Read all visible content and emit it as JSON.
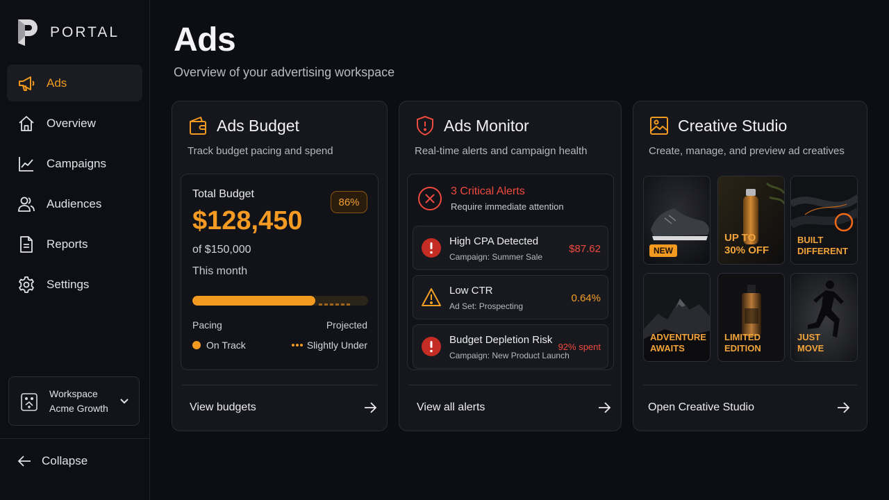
{
  "app": {
    "brand_name": "PORTAL",
    "accent_color": "#f39a20",
    "danger_color": "#ef4a3e"
  },
  "sidebar": {
    "items": [
      {
        "label": "Ads",
        "icon": "megaphone-icon",
        "active": true
      },
      {
        "label": "Overview",
        "icon": "home-icon"
      },
      {
        "label": "Campaigns",
        "icon": "line-chart-icon"
      },
      {
        "label": "Audiences",
        "icon": "users-icon"
      },
      {
        "label": "Reports",
        "icon": "document-icon"
      },
      {
        "label": "Settings",
        "icon": "gear-icon"
      }
    ],
    "workspace": {
      "label": "Workspace",
      "name": "Acme Growth"
    },
    "collapse_label": "Collapse"
  },
  "header": {
    "title": "Ads",
    "subtitle": "Overview of your advertising workspace"
  },
  "budget": {
    "title": "Ads Budget",
    "description": "Track budget pacing and spend",
    "total_label": "Total Budget",
    "percent_badge": "86%",
    "amount": "$128,450",
    "of_total": "of $150,000",
    "period": "This month",
    "progress_fraction": 0.7,
    "projected_fraction": 0.2,
    "pacing_label": "Pacing",
    "projected_label": "Projected",
    "pacing_status": "On Track",
    "projected_status": "Slightly Under",
    "link_label": "View budgets"
  },
  "monitor": {
    "title": "Ads Monitor",
    "description": "Real-time alerts and campaign health",
    "critical_title": "3 Critical Alerts",
    "critical_subtitle": "Require immediate attention",
    "alerts": [
      {
        "title": "High CPA Detected",
        "subtitle": "Campaign: Summer Sale",
        "value": "$87.62",
        "severity": "critical"
      },
      {
        "title": "Low CTR",
        "subtitle": "Ad Set: Prospecting",
        "value": "0.64%",
        "severity": "warning"
      },
      {
        "title": "Budget Depletion Risk",
        "subtitle": "Campaign: New Product Launch",
        "value": "92% spent",
        "severity": "critical"
      }
    ],
    "link_label": "View all alerts"
  },
  "creative": {
    "title": "Creative Studio",
    "description": "Create, manage, and preview ad creatives",
    "tiles": [
      {
        "label": "NEW"
      },
      {
        "label": "UP TO\n30% OFF"
      },
      {
        "label": "BUILT\nDIFFERENT"
      },
      {
        "label": "ADVENTURE\nAWAITS"
      },
      {
        "label": "LIMITED\nEDITION"
      },
      {
        "label": "JUST\nMOVE"
      }
    ],
    "link_label": "Open Creative Studio"
  }
}
